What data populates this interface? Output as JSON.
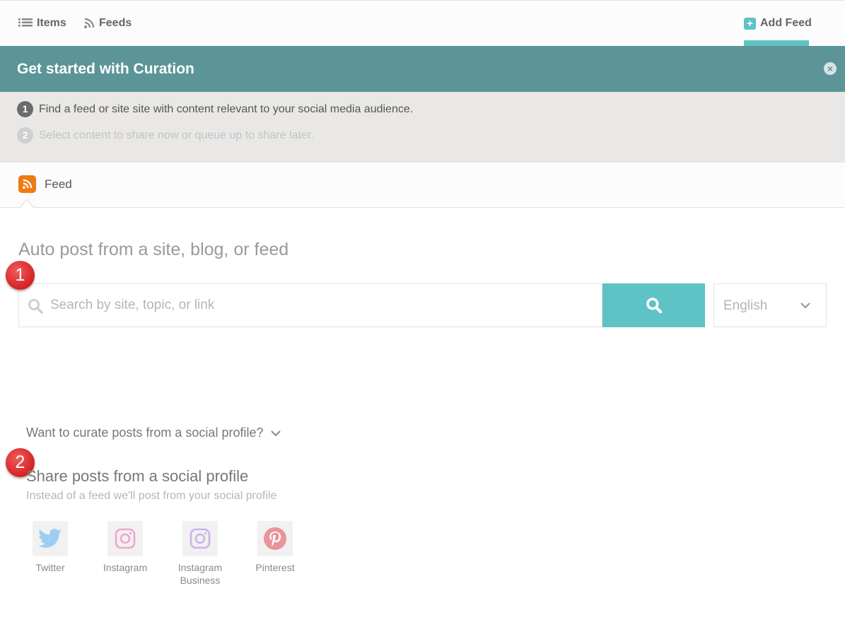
{
  "nav": {
    "items_label": "Items",
    "feeds_label": "Feeds",
    "add_feed_label": "Add Feed"
  },
  "banner": {
    "title": "Get started with Curation",
    "close_glyph": "×"
  },
  "steps": [
    {
      "number": "1",
      "text": "Find a feed or site site with content relevant to your social media audience."
    },
    {
      "number": "2",
      "text": "Select content to share now or queue up to share later."
    }
  ],
  "tab": {
    "feed_label": "Feed"
  },
  "auto_post": {
    "title": "Auto post from a site, blog, or feed",
    "search_placeholder": "Search by site, topic, or link",
    "search_value": "",
    "language": "English"
  },
  "markers": [
    "1",
    "2"
  ],
  "social": {
    "toggle_label": "Want to curate posts from a social profile?",
    "title": "Share posts from a social profile",
    "subtitle": "Instead of a feed we'll post from your social profile",
    "profiles": [
      {
        "label": "Twitter",
        "icon": "twitter-icon",
        "color": "#9ecdf2"
      },
      {
        "label": "Instagram",
        "icon": "instagram-icon",
        "color": "#f0a7cb"
      },
      {
        "label": "Instagram Business",
        "label_line1": "Instagram",
        "label_line2": "Business",
        "icon": "instagram-icon",
        "color": "#cdb3ec"
      },
      {
        "label": "Pinterest",
        "icon": "pinterest-icon",
        "color": "#e9939b"
      }
    ]
  },
  "colors": {
    "accent": "#5fc2c5",
    "banner": "#5b9597",
    "rss": "#ef7a14",
    "marker": "#d42222"
  }
}
